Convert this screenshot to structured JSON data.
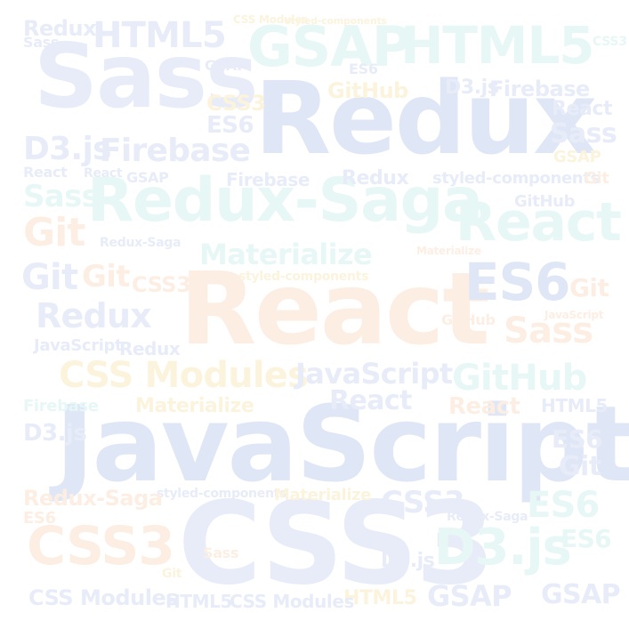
{
  "word_cloud": {
    "colors": {
      "blue": "#e7ecf8",
      "peach": "#fdeee3",
      "cyan": "#e6f7f5",
      "cream": "#fbf3dc"
    },
    "words": {
      "javascript_large": "JavaScript",
      "react_large": "React",
      "css3_large": "CSS3",
      "redux_large": "Redux",
      "sass_large": "Sass",
      "redux_saga_large": "Redux-Saga",
      "gsap_top": "GSAP",
      "html5_top": "HTML5",
      "html5_top_left": "HTML5",
      "redux_top_left": "Redux",
      "react_right": "React",
      "es6_right": "ES6",
      "css_modules_mid": "CSS Modules",
      "github_mid": "GitHub",
      "d3js_bottom": "D3.js",
      "css3_bottom_left": "CSS3",
      "materialize_mid": "Materialize",
      "firebase_left": "Firebase",
      "d3js_left": "D3.js",
      "redux_left": "Redux",
      "git_left_1": "Git",
      "git_left_2": "Git",
      "git_left_3": "Git",
      "sass_left": "Sass",
      "styled_components_1": "styled-components",
      "styled_components_2": "styled-components",
      "styled_components_3": "styled-components",
      "javascript_mid": "JavaScript",
      "javascript_left": "JavaScript",
      "react_mid": "React",
      "react_mid2": "React",
      "materialize_small": "Materialize",
      "materialize_bottom": "Materialize",
      "sass_right": "Sass",
      "sass_right2": "Sass",
      "sass_top_left": "Sass",
      "git_right": "Git",
      "git_right2": "Git",
      "css3_mid": "CSS3",
      "css3_mid2": "CSS3",
      "css3_top": "CSS3",
      "es6_top": "ES6",
      "es6_mid": "ES6",
      "es6_bottom": "ES6",
      "es6_left": "ES6",
      "es6_bottom_left": "ES6",
      "gsap_bottom": "GSAP",
      "gsap_bottom2": "GSAP",
      "gsap_small": "GSAP",
      "github_top": "GitHub",
      "github_right": "GitHub",
      "github_small": "GitHub",
      "firebase_top": "Firebase",
      "firebase_mid": "Firebase",
      "firebase_right": "Firebase",
      "d3js_top": "D3.js",
      "d3js_bottom2": "D3.js",
      "d3js_left2": "D3.js",
      "html5_bottom": "HTML5",
      "html5_bottom2": "HTML5",
      "html5_right": "HTML5",
      "redux_saga_bottom": "Redux-Saga",
      "redux_saga_mid": "Redux-Saga",
      "redux_saga_right": "Redux-Saga",
      "css_modules_bottom": "CSS Modules",
      "css_modules_bottom2": "CSS Modules",
      "react_left": "React",
      "react_left2": "React",
      "redux_mid": "Redux",
      "redux_mid2": "Redux",
      "sass_bottom": "Sass",
      "git_bottom": "Git",
      "gsap_top2": "GSAP",
      "react_top_right": "React",
      "git_top_right": "Git",
      "gsap_top_right": "GSAP",
      "css3_top_right": "CSS3",
      "es6_mid_left": "ES6",
      "css_modules_top": "CSS Modules",
      "styled_components_top": "styled-components",
      "javascript_right": "JavaScript",
      "materialize_right": "Materialize"
    }
  }
}
